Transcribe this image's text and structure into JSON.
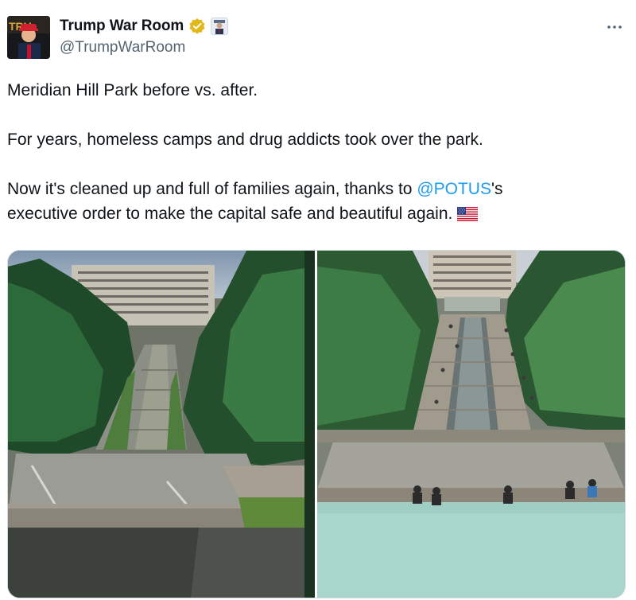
{
  "account": {
    "display_name": "Trump War Room",
    "handle": "@TrumpWarRoom",
    "verified_badge_icon": "gold-verified-check-icon",
    "affiliate_badge_icon": "affiliate-portrait-icon",
    "avatar_icon": "profile-avatar"
  },
  "tweet": {
    "line1": "Meridian Hill Park before vs. after.",
    "line2": "For years, homeless camps and drug addicts took over the park.",
    "line3_before": "Now it's cleaned up and full of families again, thanks to ",
    "line3_mention": "@POTUS",
    "line3_after": "'s",
    "line4": "executive order to make the capital safe and beautiful again.",
    "emoji_icon": "us-flag-emoji"
  },
  "more_menu_icon": "more-options-icon",
  "media": {
    "photos": [
      {
        "icon": "park-before-photo"
      },
      {
        "icon": "park-after-photo"
      }
    ]
  },
  "colors": {
    "text": "#0f1419",
    "secondary": "#536471",
    "link": "#1d9bf0",
    "verified_gold": "#e2b719",
    "border": "#cfd9de"
  }
}
